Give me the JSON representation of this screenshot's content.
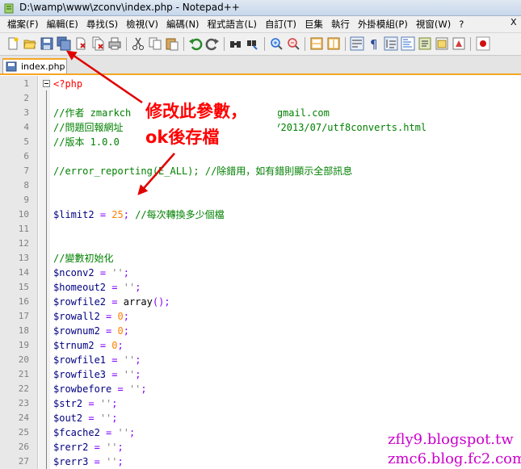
{
  "window": {
    "title": "D:\\wamp\\www\\zconv\\index.php - Notepad++",
    "app_icon": "notepad-plus-plus-icon"
  },
  "menu": {
    "items": [
      "檔案(F)",
      "編輯(E)",
      "尋找(S)",
      "檢視(V)",
      "編碼(N)",
      "程式語言(L)",
      "自訂(T)",
      "巨集",
      "執行",
      "外掛模組(P)",
      "視窗(W)",
      "?"
    ],
    "close_glyph": "X"
  },
  "toolbar": {
    "icons": [
      "new-file-icon",
      "open-file-icon",
      "save-icon",
      "save-all-icon",
      "close-icon",
      "close-all-icon",
      "print-icon",
      "cut-icon",
      "copy-icon",
      "paste-icon",
      "undo-icon",
      "redo-icon",
      "find-icon",
      "replace-icon",
      "zoom-in-icon",
      "zoom-out-icon",
      "sync-v-icon",
      "sync-h-icon",
      "word-wrap-icon",
      "show-all-chars-icon",
      "indent-guide-icon",
      "doc-map-icon",
      "function-list-icon",
      "folder-icon",
      "record-macro-icon"
    ]
  },
  "tab": {
    "label": "index.php",
    "icon": "saved-file-icon"
  },
  "editor": {
    "lines": [
      {
        "n": "1",
        "text": "<?php"
      },
      {
        "n": "2",
        "text": ""
      },
      {
        "n": "3",
        "text": "//作者 zmarkch                    hang@gmail.com"
      },
      {
        "n": "4",
        "text": "//問題回報網址                    ot.com/2013/07/utf8converts.html"
      },
      {
        "n": "5",
        "text": "//版本 1.0.0"
      },
      {
        "n": "6",
        "text": ""
      },
      {
        "n": "7",
        "text": "//error_reporting(E_ALL); //除錯用，如有錯則顯示全部訊息"
      },
      {
        "n": "8",
        "text": ""
      },
      {
        "n": "9",
        "text": ""
      },
      {
        "n": "10",
        "text": "$limit2 = 25; //每次轉換多少個檔"
      },
      {
        "n": "11",
        "text": ""
      },
      {
        "n": "12",
        "text": ""
      },
      {
        "n": "13",
        "text": "//變數初始化"
      },
      {
        "n": "14",
        "text": "$nconv2 = '';"
      },
      {
        "n": "15",
        "text": "$homeout2 = '';"
      },
      {
        "n": "16",
        "text": "$rowfile2 = array();"
      },
      {
        "n": "17",
        "text": "$rowall2 = 0;"
      },
      {
        "n": "18",
        "text": "$rownum2 = 0;"
      },
      {
        "n": "19",
        "text": "$trnum2 = 0;"
      },
      {
        "n": "20",
        "text": "$rowfile1 = '';"
      },
      {
        "n": "21",
        "text": "$rowfile3 = '';"
      },
      {
        "n": "22",
        "text": "$rowbefore = '';"
      },
      {
        "n": "23",
        "text": "$str2 = '';"
      },
      {
        "n": "24",
        "text": "$out2 = '';"
      },
      {
        "n": "25",
        "text": "$fcache2 = '';"
      },
      {
        "n": "26",
        "text": "$rerr2 = '';"
      },
      {
        "n": "27",
        "text": "$rerr3 = '';"
      }
    ]
  },
  "annotation": {
    "line1": "修改此參數，",
    "line2": "ok後存檔",
    "color": "#ff0000"
  },
  "watermark": {
    "line1": "zfly9.blogspot.tw",
    "line2": "zmc6.blog.fc2.com",
    "color": "#cc00cc"
  }
}
